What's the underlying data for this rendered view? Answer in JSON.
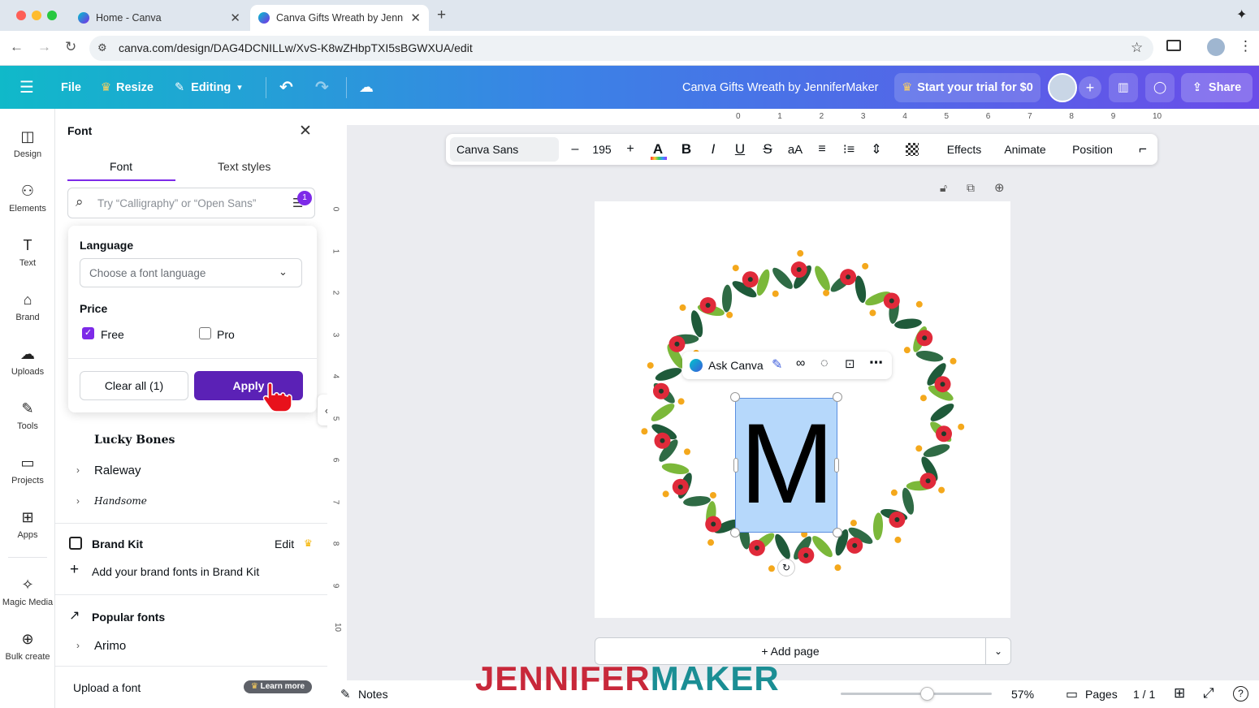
{
  "browser": {
    "tabs": [
      {
        "title": "Home - Canva"
      },
      {
        "title": "Canva Gifts Wreath by JenniferMaker"
      }
    ],
    "url": "canva.com/design/DAG4DCNILLw/XvS-K8wZHbpTXI5sBGWXUA/edit"
  },
  "topbar": {
    "file": "File",
    "resize": "Resize",
    "editing": "Editing",
    "doc_title": "Canva Gifts Wreath by JenniferMaker",
    "trial": "Start your trial for $0",
    "share": "Share"
  },
  "leftnav": [
    {
      "label": "Design",
      "icon": "design-icon"
    },
    {
      "label": "Elements",
      "icon": "elements-icon"
    },
    {
      "label": "Text",
      "icon": "text-icon"
    },
    {
      "label": "Brand",
      "icon": "brand-icon"
    },
    {
      "label": "Uploads",
      "icon": "uploads-icon"
    },
    {
      "label": "Tools",
      "icon": "tools-icon"
    },
    {
      "label": "Projects",
      "icon": "projects-icon"
    },
    {
      "label": "Apps",
      "icon": "apps-icon"
    },
    {
      "label": "Magic Media",
      "icon": "magic-media-icon"
    },
    {
      "label": "Bulk create",
      "icon": "bulk-create-icon"
    }
  ],
  "panel": {
    "title": "Font",
    "tabs": [
      "Font",
      "Text styles"
    ],
    "search_placeholder": "Try “Calligraphy” or “Open Sans”",
    "filter_count": "1",
    "fonts_partial": [
      "Lucky Bones",
      "Raleway",
      "Handsome"
    ],
    "brand_kit": "Brand Kit",
    "brand_edit": "Edit",
    "add_brand_fonts": "Add your brand fonts in Brand Kit",
    "popular_fonts": "Popular fonts",
    "arimo": "Arimo",
    "upload_font": "Upload a font",
    "learn_more": "Learn more"
  },
  "filter_popup": {
    "language_label": "Language",
    "language_placeholder": "Choose a font language",
    "price_label": "Price",
    "free": "Free",
    "free_checked": true,
    "pro": "Pro",
    "pro_checked": false,
    "clear": "Clear all (1)",
    "apply": "Apply"
  },
  "format_toolbar": {
    "font": "Canva Sans",
    "size": "195",
    "minus": "–",
    "plus": "+",
    "effects": "Effects",
    "animate": "Animate",
    "position": "Position"
  },
  "ruler_top": [
    "0",
    "1",
    "2",
    "3",
    "4",
    "5",
    "6",
    "7",
    "8",
    "9",
    "10"
  ],
  "ruler_left": [
    "0",
    "1",
    "2",
    "3",
    "4",
    "5",
    "6",
    "7",
    "8",
    "9",
    "10"
  ],
  "canvas": {
    "ask_canva": "Ask Canva",
    "letter": "M",
    "add_page": "+ Add page"
  },
  "bottombar": {
    "notes": "Notes",
    "zoom": "57%",
    "zoom_level": 0.57,
    "pages": "Pages",
    "page_count": "1 / 1"
  },
  "watermark": {
    "part1": "JENNIFER",
    "part2": "MAKER"
  },
  "colors": {
    "accent": "#7d2ae8",
    "apply": "#5b21b6",
    "selection": "#b6d8fb",
    "brand_red": "#c8283a",
    "brand_teal": "#1b8e94"
  }
}
